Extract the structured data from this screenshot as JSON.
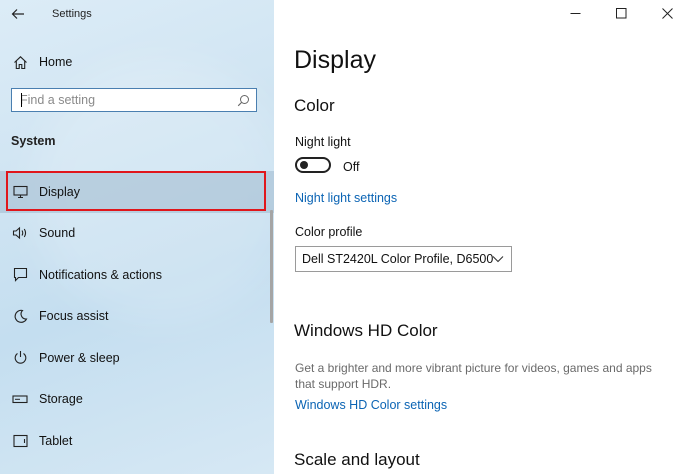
{
  "window": {
    "title": "Settings",
    "controls": {
      "minimize": "minimize-icon",
      "maximize": "maximize-icon",
      "close": "close-icon"
    }
  },
  "sidebar": {
    "home_label": "Home",
    "search": {
      "placeholder": "Find a setting",
      "value": ""
    },
    "section_title": "System",
    "items": [
      {
        "label": "Display",
        "icon": "monitor-icon",
        "selected": true
      },
      {
        "label": "Sound",
        "icon": "speaker-icon"
      },
      {
        "label": "Notifications & actions",
        "icon": "notification-icon"
      },
      {
        "label": "Focus assist",
        "icon": "moon-icon"
      },
      {
        "label": "Power & sleep",
        "icon": "power-icon"
      },
      {
        "label": "Storage",
        "icon": "storage-icon"
      },
      {
        "label": "Tablet",
        "icon": "tablet-icon"
      }
    ]
  },
  "main": {
    "title": "Display",
    "color": {
      "heading": "Color",
      "night_light_label": "Night light",
      "night_light_state": "Off",
      "night_light_settings_link": "Night light settings",
      "color_profile_label": "Color profile",
      "color_profile_value": "Dell ST2420L Color Profile, D6500"
    },
    "hd_color": {
      "heading": "Windows HD Color",
      "description": "Get a brighter and more vibrant picture for videos, games and apps that support HDR.",
      "settings_link": "Windows HD Color settings"
    },
    "scale": {
      "heading": "Scale and layout"
    }
  },
  "colors": {
    "accent_link": "#0b64b4",
    "highlight_border": "#e0161b"
  }
}
